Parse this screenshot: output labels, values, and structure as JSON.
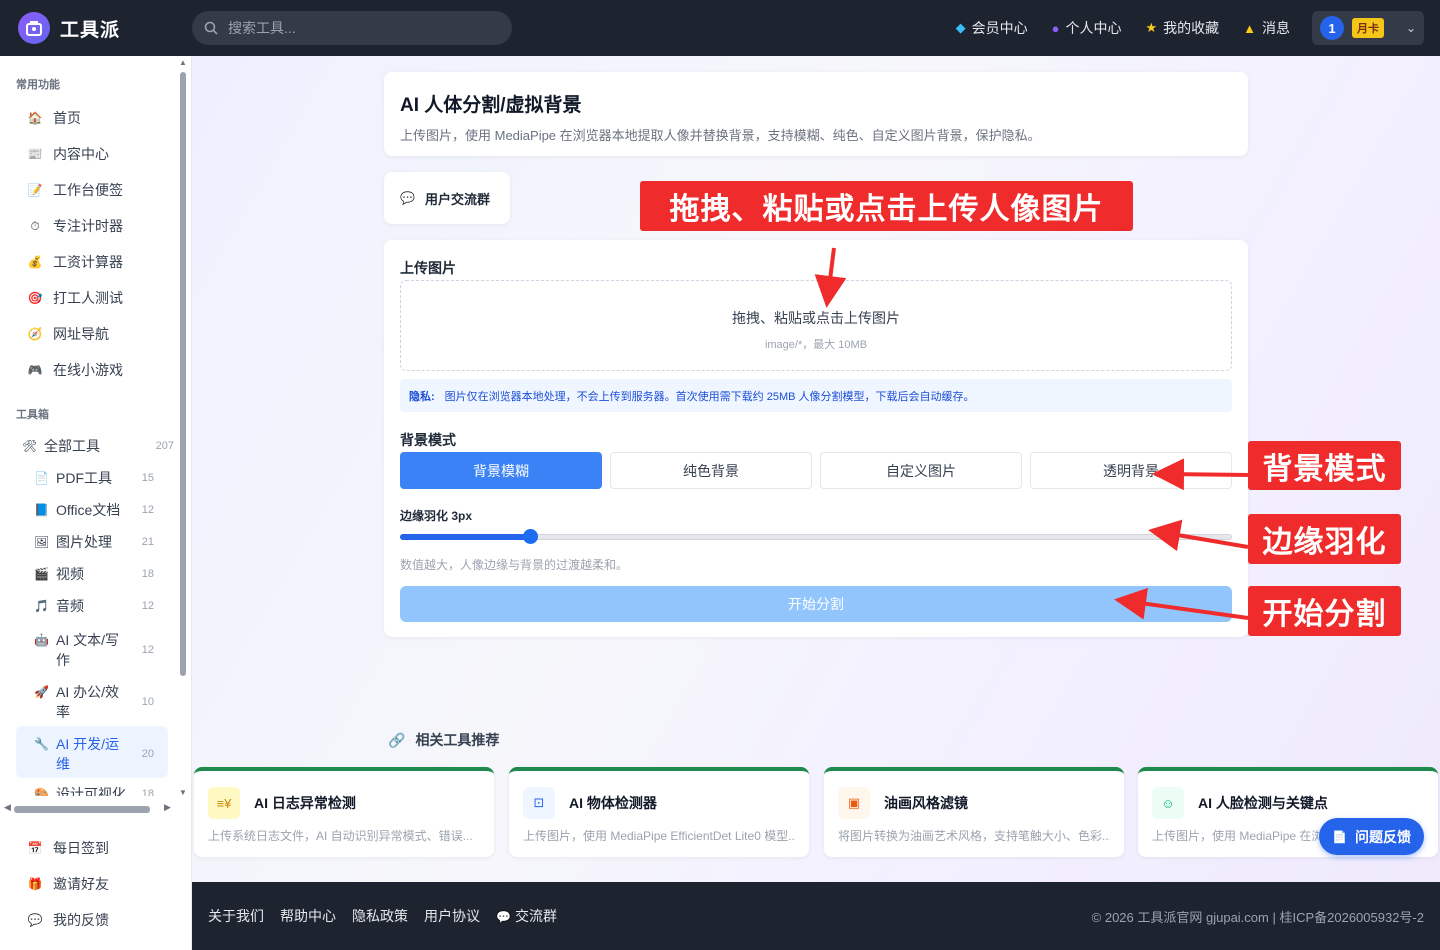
{
  "header": {
    "brand": "工具派",
    "search_placeholder": "搜索工具...",
    "nav": [
      {
        "label": "会员中心",
        "icon": "diamond-icon"
      },
      {
        "label": "个人中心",
        "icon": "user-icon"
      },
      {
        "label": "我的收藏",
        "icon": "star-icon"
      },
      {
        "label": "消息",
        "icon": "bell-icon"
      }
    ],
    "user_avatar": "1",
    "membership_badge": "月卡"
  },
  "sidebar": {
    "common_title": "常用功能",
    "common": [
      {
        "label": "首页",
        "icon": "🏠"
      },
      {
        "label": "内容中心",
        "icon": "📰"
      },
      {
        "label": "工作台便签",
        "icon": "📝"
      },
      {
        "label": "专注计时器",
        "icon": "⏱"
      },
      {
        "label": "工资计算器",
        "icon": "💰"
      },
      {
        "label": "打工人测试",
        "icon": "🎯"
      },
      {
        "label": "网址导航",
        "icon": "🧭"
      },
      {
        "label": "在线小游戏",
        "icon": "🎮"
      }
    ],
    "toolbox_title": "工具箱",
    "all_tools": {
      "label": "全部工具",
      "count": "207"
    },
    "categories": [
      {
        "label": "PDF工具",
        "count": "15",
        "icon": "📄"
      },
      {
        "label": "Office文档",
        "count": "12",
        "icon": "📘"
      },
      {
        "label": "图片处理",
        "count": "21",
        "icon": "🖼"
      },
      {
        "label": "视频",
        "count": "18",
        "icon": "🎬"
      },
      {
        "label": "音频",
        "count": "12",
        "icon": "🎵"
      },
      {
        "label": "AI 文本/写作",
        "count": "12",
        "icon": "🤖"
      },
      {
        "label": "AI 办公/效率",
        "count": "10",
        "icon": "🚀"
      },
      {
        "label": "AI 开发/运维",
        "count": "20",
        "icon": "🔧"
      },
      {
        "label": "设计可视化",
        "count": "18",
        "icon": "🎨"
      }
    ],
    "bottom": [
      {
        "label": "每日签到",
        "icon": "📅"
      },
      {
        "label": "邀请好友",
        "icon": "🎁"
      },
      {
        "label": "我的反馈",
        "icon": "💬"
      }
    ]
  },
  "page": {
    "title": "AI 人体分割/虚拟背景",
    "subtitle": "上传图片，使用 MediaPipe 在浏览器本地提取人像并替换背景，支持模糊、纯色、自定义图片背景，保护隐私。",
    "group_label": "用户交流群",
    "upload_label": "上传图片",
    "dropzone_main": "拖拽、粘贴或点击上传图片",
    "dropzone_sub": "image/*，最大 10MB",
    "privacy_title": "隐私:",
    "privacy_text": "图片仅在浏览器本地处理，不会上传到服务器。首次使用需下载约 25MB 人像分割模型，下载后会自动缓存。",
    "bg_mode_label": "背景模式",
    "bg_modes": [
      "背景模糊",
      "纯色背景",
      "自定义图片",
      "透明背景"
    ],
    "bg_mode_selected": "背景模糊",
    "feather_label": "边缘羽化 3px",
    "feather_value": 3,
    "feather_fraction": 0.156,
    "feather_hint": "数值越大，人像边缘与背景的过渡越柔和。",
    "start_button": "开始分割"
  },
  "annotations": {
    "upload": "拖拽、粘贴或点击上传人像图片",
    "bg_mode": "背景模式",
    "feather": "边缘羽化",
    "start": "开始分割"
  },
  "related": {
    "title": "相关工具推荐",
    "items": [
      {
        "name": "AI 日志异常检测",
        "desc": "上传系统日志文件，AI 自动识别异常模式、错误...",
        "icon": "≡¥"
      },
      {
        "name": "AI 物体检测器",
        "desc": "上传图片，使用 MediaPipe EfficientDet Lite0 模型...",
        "icon": "⊡"
      },
      {
        "name": "油画风格滤镜",
        "desc": "将图片转换为油画艺术风格，支持笔触大小、色彩...",
        "icon": "▣"
      },
      {
        "name": "AI 人脸检测与关键点",
        "desc": "上传图片，使用 MediaPipe 在浏",
        "icon": "☺"
      }
    ],
    "feedback_button": "问题反馈"
  },
  "footer": {
    "links": [
      "关于我们",
      "帮助中心",
      "隐私政策",
      "用户协议",
      "交流群"
    ],
    "copyright": "© 2026 工具派官网 gjupai.com | 桂ICP备2026005932号-2"
  },
  "colors": {
    "topbar": "#1e2330",
    "primary": "#3b82f6",
    "start_disabled": "#93c5fd",
    "annotation": "#ef2b2b",
    "related_accent": "#1f8a4c"
  }
}
